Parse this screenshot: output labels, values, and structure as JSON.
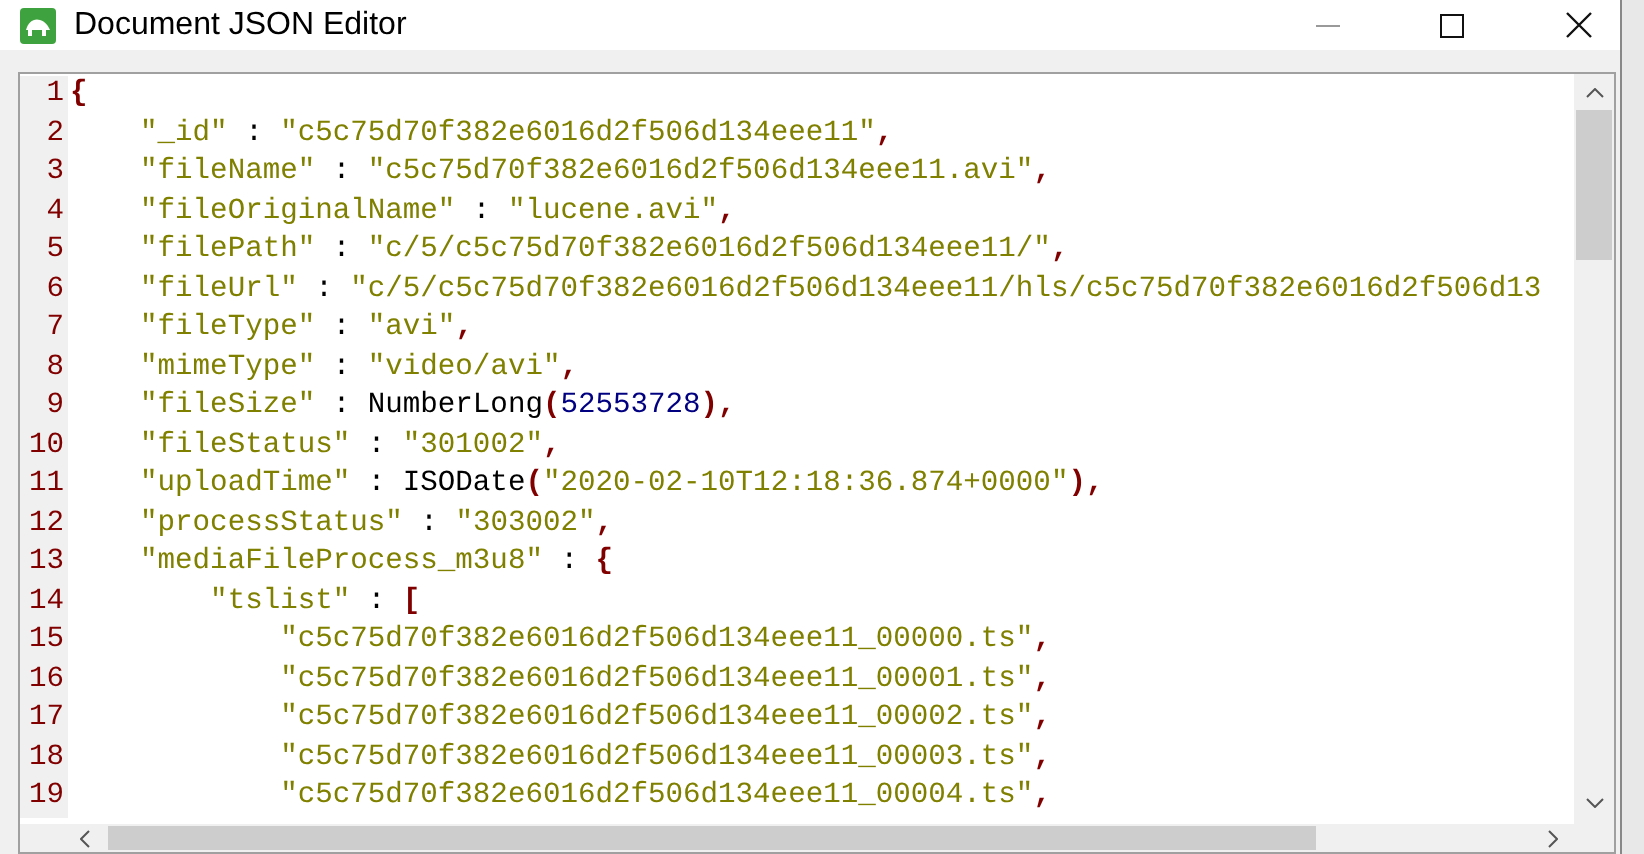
{
  "window": {
    "title": "Document JSON Editor"
  },
  "editor": {
    "lines": [
      {
        "number": "1",
        "tokens": [
          {
            "kind": "punct",
            "text": "{"
          }
        ]
      },
      {
        "number": "2",
        "tokens": [
          {
            "kind": "key",
            "text": "    \"_id\""
          },
          {
            "kind": "plain",
            "text": " : "
          },
          {
            "kind": "str",
            "text": "\"c5c75d70f382e6016d2f506d134eee11\""
          },
          {
            "kind": "punct",
            "text": ","
          }
        ]
      },
      {
        "number": "3",
        "tokens": [
          {
            "kind": "key",
            "text": "    \"fileName\""
          },
          {
            "kind": "plain",
            "text": " : "
          },
          {
            "kind": "str",
            "text": "\"c5c75d70f382e6016d2f506d134eee11.avi\""
          },
          {
            "kind": "punct",
            "text": ","
          }
        ]
      },
      {
        "number": "4",
        "tokens": [
          {
            "kind": "key",
            "text": "    \"fileOriginalName\""
          },
          {
            "kind": "plain",
            "text": " : "
          },
          {
            "kind": "str",
            "text": "\"lucene.avi\""
          },
          {
            "kind": "punct",
            "text": ","
          }
        ]
      },
      {
        "number": "5",
        "tokens": [
          {
            "kind": "key",
            "text": "    \"filePath\""
          },
          {
            "kind": "plain",
            "text": " : "
          },
          {
            "kind": "str",
            "text": "\"c/5/c5c75d70f382e6016d2f506d134eee11/\""
          },
          {
            "kind": "punct",
            "text": ","
          }
        ]
      },
      {
        "number": "6",
        "tokens": [
          {
            "kind": "key",
            "text": "    \"fileUrl\""
          },
          {
            "kind": "plain",
            "text": " : "
          },
          {
            "kind": "str",
            "text": "\"c/5/c5c75d70f382e6016d2f506d134eee11/hls/c5c75d70f382e6016d2f506d13"
          }
        ]
      },
      {
        "number": "7",
        "tokens": [
          {
            "kind": "key",
            "text": "    \"fileType\""
          },
          {
            "kind": "plain",
            "text": " : "
          },
          {
            "kind": "str",
            "text": "\"avi\""
          },
          {
            "kind": "punct",
            "text": ","
          }
        ]
      },
      {
        "number": "8",
        "tokens": [
          {
            "kind": "key",
            "text": "    \"mimeType\""
          },
          {
            "kind": "plain",
            "text": " : "
          },
          {
            "kind": "str",
            "text": "\"video/avi\""
          },
          {
            "kind": "punct",
            "text": ","
          }
        ]
      },
      {
        "number": "9",
        "tokens": [
          {
            "kind": "key",
            "text": "    \"fileSize\""
          },
          {
            "kind": "plain",
            "text": " : NumberLong"
          },
          {
            "kind": "punct",
            "text": "("
          },
          {
            "kind": "num",
            "text": "52553728"
          },
          {
            "kind": "punct",
            "text": "),"
          }
        ]
      },
      {
        "number": "10",
        "tokens": [
          {
            "kind": "key",
            "text": "    \"fileStatus\""
          },
          {
            "kind": "plain",
            "text": " : "
          },
          {
            "kind": "str",
            "text": "\"301002\""
          },
          {
            "kind": "punct",
            "text": ","
          }
        ]
      },
      {
        "number": "11",
        "tokens": [
          {
            "kind": "key",
            "text": "    \"uploadTime\""
          },
          {
            "kind": "plain",
            "text": " : ISODate"
          },
          {
            "kind": "punct",
            "text": "("
          },
          {
            "kind": "str",
            "text": "\"2020-02-10T12:18:36.874+0000\""
          },
          {
            "kind": "punct",
            "text": "),"
          }
        ]
      },
      {
        "number": "12",
        "tokens": [
          {
            "kind": "key",
            "text": "    \"processStatus\""
          },
          {
            "kind": "plain",
            "text": " : "
          },
          {
            "kind": "str",
            "text": "\"303002\""
          },
          {
            "kind": "punct",
            "text": ","
          }
        ]
      },
      {
        "number": "13",
        "tokens": [
          {
            "kind": "key",
            "text": "    \"mediaFileProcess_m3u8\""
          },
          {
            "kind": "plain",
            "text": " : "
          },
          {
            "kind": "punct",
            "text": "{"
          }
        ]
      },
      {
        "number": "14",
        "tokens": [
          {
            "kind": "key",
            "text": "        \"tslist\""
          },
          {
            "kind": "plain",
            "text": " : "
          },
          {
            "kind": "punct",
            "text": "["
          }
        ]
      },
      {
        "number": "15",
        "tokens": [
          {
            "kind": "str",
            "text": "            \"c5c75d70f382e6016d2f506d134eee11_00000.ts\""
          },
          {
            "kind": "punct",
            "text": ","
          }
        ]
      },
      {
        "number": "16",
        "tokens": [
          {
            "kind": "str",
            "text": "            \"c5c75d70f382e6016d2f506d134eee11_00001.ts\""
          },
          {
            "kind": "punct",
            "text": ","
          }
        ]
      },
      {
        "number": "17",
        "tokens": [
          {
            "kind": "str",
            "text": "            \"c5c75d70f382e6016d2f506d134eee11_00002.ts\""
          },
          {
            "kind": "punct",
            "text": ","
          }
        ]
      },
      {
        "number": "18",
        "tokens": [
          {
            "kind": "str",
            "text": "            \"c5c75d70f382e6016d2f506d134eee11_00003.ts\""
          },
          {
            "kind": "punct",
            "text": ","
          }
        ]
      },
      {
        "number": "19",
        "tokens": [
          {
            "kind": "str",
            "text": "            \"c5c75d70f382e6016d2f506d134eee11_00004.ts\""
          },
          {
            "kind": "punct",
            "text": ","
          }
        ]
      }
    ]
  }
}
